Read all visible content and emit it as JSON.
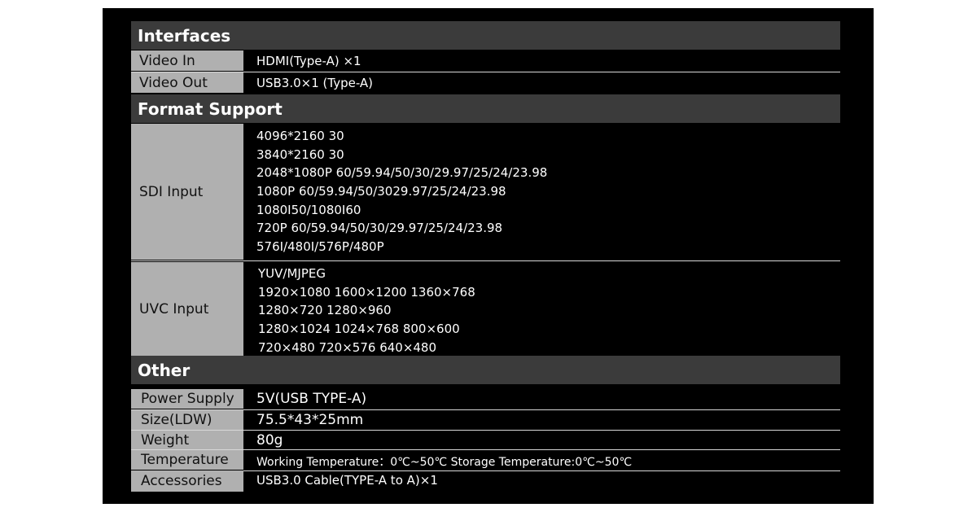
{
  "sections": {
    "interfaces": "Interfaces",
    "format_support": "Format Support",
    "other": "Other"
  },
  "interfaces": {
    "video_in": {
      "label": "Video In",
      "value": "HDMI(Type-A) ×1"
    },
    "video_out": {
      "label": "Video Out",
      "value": "USB3.0×1 (Type-A)"
    }
  },
  "format_support": {
    "sdi_input": {
      "label": "SDI Input",
      "lines": [
        "4096*2160 30",
        "3840*2160 30",
        "2048*1080P 60/59.94/50/30/29.97/25/24/23.98",
        "1080P 60/59.94/50/3029.97/25/24/23.98",
        "1080I50/1080I60",
        "720P 60/59.94/50/30/29.97/25/24/23.98",
        "576I/480I/576P/480P"
      ]
    },
    "uvc_input": {
      "label": "UVC Input",
      "lines": [
        "YUV/MJPEG",
        "1920×1080 1600×1200 1360×768",
        "1280×720 1280×960",
        "1280×1024 1024×768 800×600",
        "720×480 720×576 640×480"
      ]
    }
  },
  "other": {
    "power_supply": {
      "label": "Power Supply",
      "value": "5V(USB TYPE-A)"
    },
    "size": {
      "label": "Size(LDW)",
      "value": "75.5*43*25mm"
    },
    "weight": {
      "label": "Weight",
      "value": "80g"
    },
    "temperature": {
      "label": "Temperature",
      "value": "Working Temperature：0℃~50℃  Storage Temperature:0℃~50℃"
    },
    "accessories": {
      "label": "Accessories",
      "value": "USB3.0 Cable(TYPE-A to A)×1"
    }
  },
  "colors": {
    "panel_bg": "#000000",
    "section_header_bg": "#3b3b3b",
    "label_cell_bg": "#b0b0b0",
    "value_text": "#ffffff"
  }
}
